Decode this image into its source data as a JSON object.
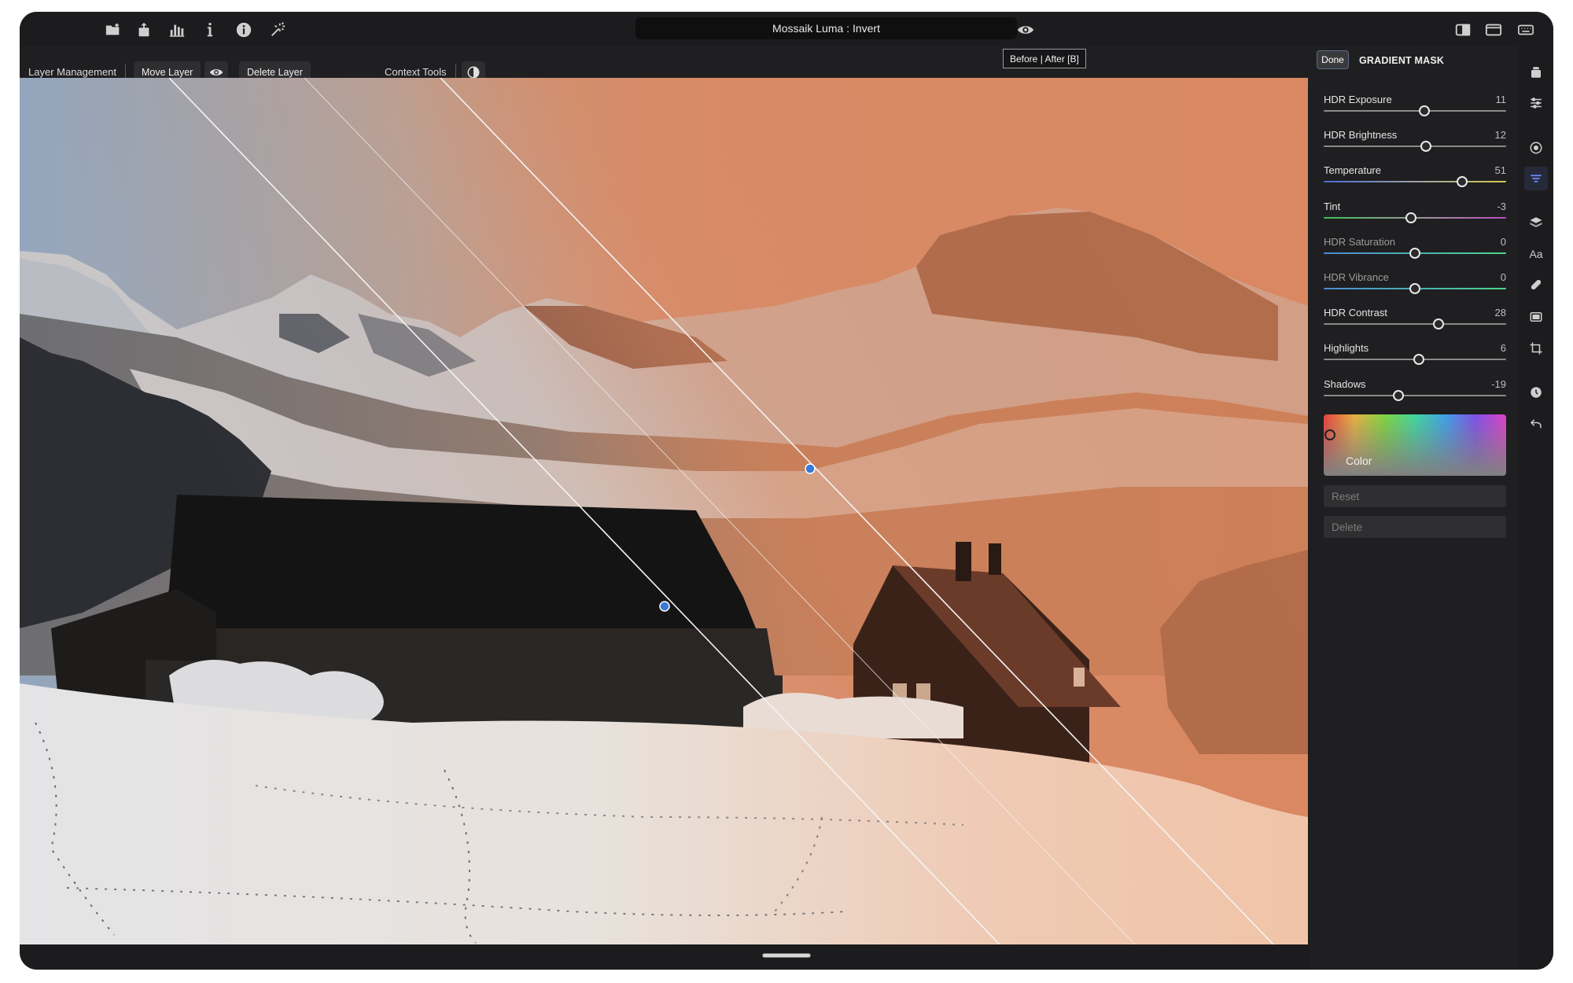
{
  "app": {
    "title": "Mossaik Luma : Invert",
    "accent_color": "#3a7bd5"
  },
  "topbar": {
    "left_icons": [
      "open-folder-icon",
      "share-icon",
      "histogram-icon",
      "info-letter-icon",
      "info-circle-icon",
      "magic-wand-icon"
    ],
    "right_icons": [
      "eye-icon",
      "split-view-icon",
      "single-view-icon",
      "keyboard-icon"
    ]
  },
  "context_bar": {
    "layer_management_label": "Layer Management",
    "move_layer_label": "Move Layer",
    "delete_layer_label": "Delete Layer",
    "context_tools_label": "Context Tools",
    "tooltip": "Before | After [B]"
  },
  "panel": {
    "done_label": "Done",
    "title": "GRADIENT MASK",
    "sliders": [
      {
        "label": "HDR Exposure",
        "value": "11",
        "position": 0.55,
        "dim": false,
        "track": "#8a8a8a"
      },
      {
        "label": "HDR Brightness",
        "value": "12",
        "position": 0.56,
        "dim": false,
        "track": "#8a8a8a"
      },
      {
        "label": "Temperature",
        "value": "51",
        "position": 0.76,
        "dim": false,
        "track": "linear-gradient(to right,#4b6cd6,#9aa0a6,#d6c84b)"
      },
      {
        "label": "Tint",
        "value": "-3",
        "position": 0.48,
        "dim": false,
        "track": "linear-gradient(to right,#3fbf5a,#9a9a9a,#c04bc0)"
      },
      {
        "label": "HDR Saturation",
        "value": "0",
        "position": 0.5,
        "dim": true,
        "track": "linear-gradient(to right,#4b8bd6,#4bd68b)"
      },
      {
        "label": "HDR Vibrance",
        "value": "0",
        "position": 0.5,
        "dim": true,
        "track": "linear-gradient(to right,#4b8bd6,#4bd68b)"
      },
      {
        "label": "HDR Contrast",
        "value": "28",
        "position": 0.63,
        "dim": false,
        "track": "#8a8a8a"
      },
      {
        "label": "Highlights",
        "value": "6",
        "position": 0.52,
        "dim": false,
        "track": "#8a8a8a"
      },
      {
        "label": "Shadows",
        "value": "-19",
        "position": 0.41,
        "dim": false,
        "track": "#8a8a8a"
      }
    ],
    "color_label": "Color",
    "reset_label": "Reset",
    "delete_label": "Delete"
  },
  "side_strip": {
    "icons": [
      "layers-stack-icon",
      "sliders-icon",
      "target-icon",
      "align-lines-icon",
      "layers-icon",
      "text-icon",
      "bandage-icon",
      "frame-icon",
      "crop-icon",
      "history-icon",
      "undo-icon"
    ],
    "text_icon_label": "Aa"
  }
}
